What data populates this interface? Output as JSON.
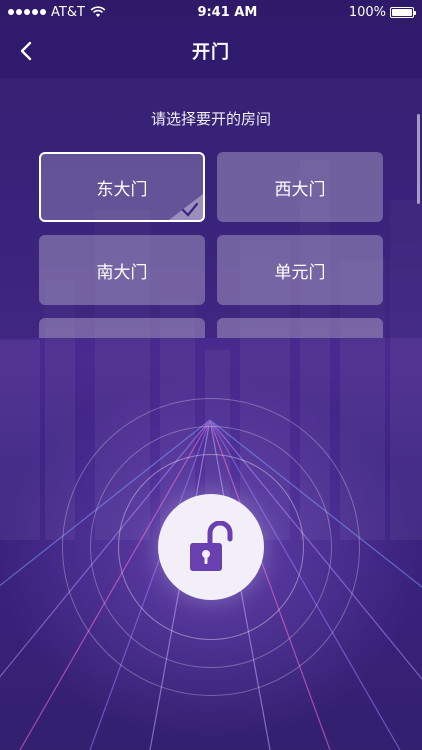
{
  "status_bar": {
    "carrier": "AT&T",
    "time": "9:41 AM",
    "battery": "100%"
  },
  "nav": {
    "title": "开门"
  },
  "panel": {
    "prompt": "请选择要开的房间",
    "rooms": [
      {
        "label": "东大门",
        "selected": true
      },
      {
        "label": "西大门",
        "selected": false
      },
      {
        "label": "南大门",
        "selected": false
      },
      {
        "label": "单元门",
        "selected": false
      },
      {
        "label": "",
        "selected": false
      },
      {
        "label": "",
        "selected": false
      }
    ]
  },
  "colors": {
    "background": "#3b2480",
    "accent": "#6a3fb0",
    "button_face": "#f2eff8"
  },
  "icons": {
    "back": "chevron-left-icon",
    "check": "checkmark-icon",
    "unlock": "unlocked-padlock-icon"
  }
}
